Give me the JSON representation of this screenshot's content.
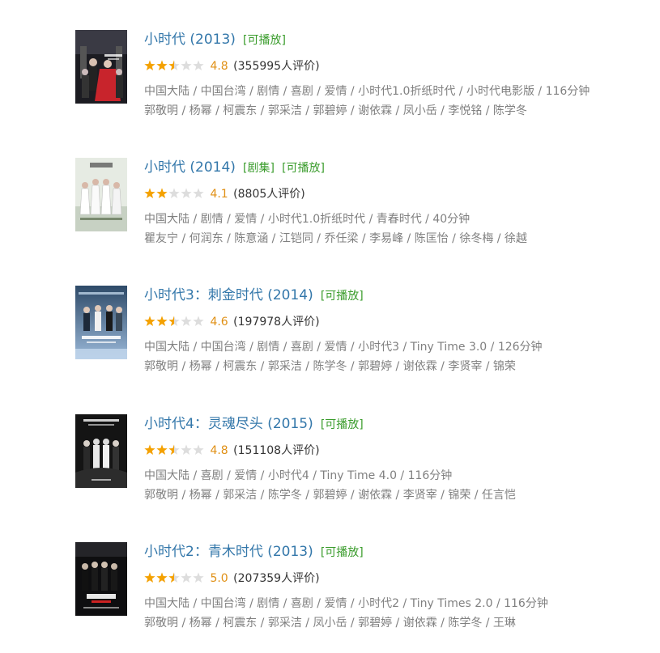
{
  "colors": {
    "title": "#3377aa",
    "playable_tag": "#3a9c2c",
    "score": "#e09015",
    "star_full": "#f4a100",
    "star_empty": "#dddddd",
    "meta": "#808080"
  },
  "results": [
    {
      "title": "小时代 (2013)",
      "tags": [
        "[可播放]"
      ],
      "stars": 2.5,
      "score": "4.8",
      "votes": "(355995人评价)",
      "meta": "中国大陆 / 中国台湾 / 剧情 / 喜剧 / 爱情 / 小时代1.0折纸时代 / 小时代电影版 / 116分钟",
      "cast": "郭敬明 / 杨幂 / 柯震东 / 郭采洁 / 郭碧婷 / 谢依霖 / 凤小岳 / 李悦铭 / 陈学冬",
      "poster_icon": "movie-poster-image"
    },
    {
      "title": "小时代 (2014)",
      "tags": [
        "[剧集]",
        "[可播放]"
      ],
      "stars": 2,
      "score": "4.1",
      "votes": "(8805人评价)",
      "meta": "中国大陆 / 剧情 / 爱情 / 小时代1.0折纸时代 / 青春时代 / 40分钟",
      "cast": "瞿友宁 / 何润东 / 陈意涵 / 江铠同 / 乔任梁 / 李易峰 / 陈匡怡 / 徐冬梅 / 徐越",
      "poster_icon": "tv-poster-image"
    },
    {
      "title": "小时代3：刺金时代 (2014)",
      "tags": [
        "[可播放]"
      ],
      "stars": 2.5,
      "score": "4.6",
      "votes": "(197978人评价)",
      "meta": "中国大陆 / 中国台湾 / 剧情 / 喜剧 / 爱情 / 小时代3 / Tiny Time 3.0 / 126分钟",
      "cast": "郭敬明 / 杨幂 / 柯震东 / 郭采洁 / 陈学冬 / 郭碧婷 / 谢依霖 / 李贤宰 / 锦荣",
      "poster_icon": "movie-poster-image"
    },
    {
      "title": "小时代4：灵魂尽头 (2015)",
      "tags": [
        "[可播放]"
      ],
      "stars": 2.5,
      "score": "4.8",
      "votes": "(151108人评价)",
      "meta": "中国大陆 / 喜剧 / 爱情 / 小时代4 / Tiny Time 4.0 / 116分钟",
      "cast": "郭敬明 / 杨幂 / 郭采洁 / 陈学冬 / 郭碧婷 / 谢依霖 / 李贤宰 / 锦荣 / 任言恺",
      "poster_icon": "movie-poster-image"
    },
    {
      "title": "小时代2：青木时代 (2013)",
      "tags": [
        "[可播放]"
      ],
      "stars": 2.5,
      "score": "5.0",
      "votes": "(207359人评价)",
      "meta": "中国大陆 / 中国台湾 / 剧情 / 喜剧 / 爱情 / 小时代2 / Tiny Times 2.0 / 116分钟",
      "cast": "郭敬明 / 杨幂 / 柯震东 / 郭采洁 / 凤小岳 / 郭碧婷 / 谢依霖 / 陈学冬 / 王琳",
      "poster_icon": "movie-poster-image"
    }
  ]
}
